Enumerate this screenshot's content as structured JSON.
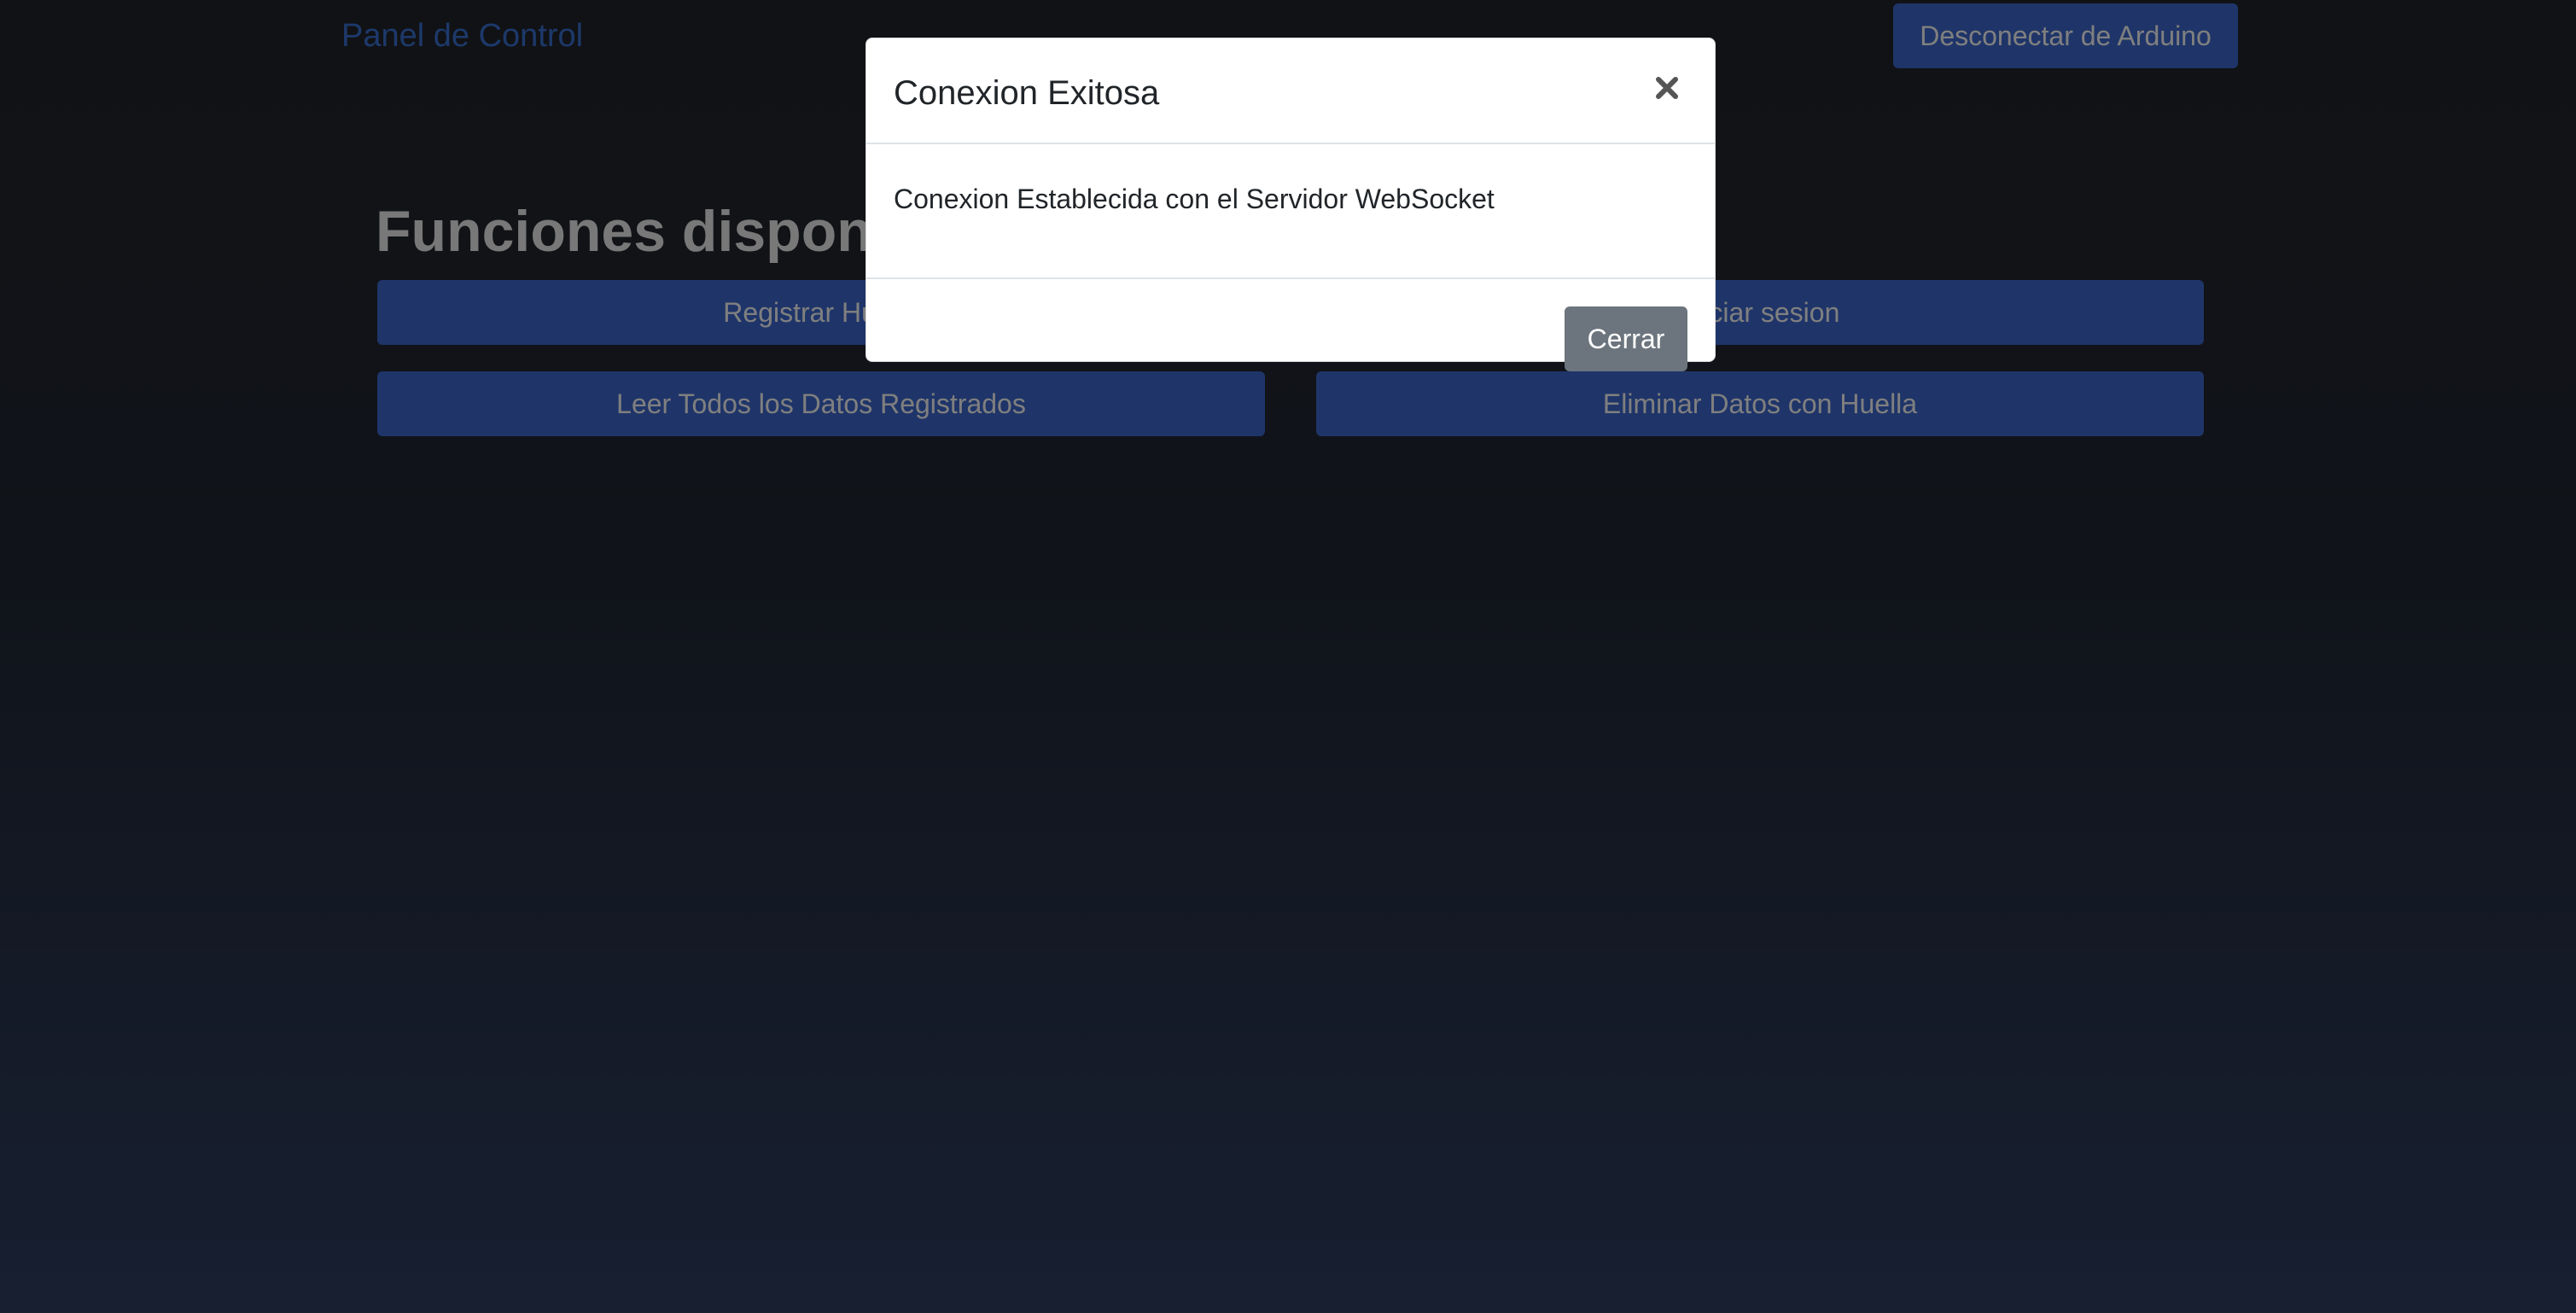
{
  "navbar": {
    "brand": "Panel de Control",
    "disconnect_label": "Desconectar de Arduino"
  },
  "main": {
    "title": "Funciones disponibles",
    "buttons": [
      "Registrar Huella",
      "Iniciar sesion",
      "Leer Todos los Datos Registrados",
      "Eliminar Datos con Huella"
    ]
  },
  "modal": {
    "title": "Conexion Exitosa",
    "close_icon": "close-icon",
    "body": "Conexion Establecida con el Servidor WebSocket",
    "close_label": "Cerrar"
  },
  "colors": {
    "primary": "#3e6ad3",
    "brand": "#3a72d6",
    "secondary": "#6c757d"
  }
}
